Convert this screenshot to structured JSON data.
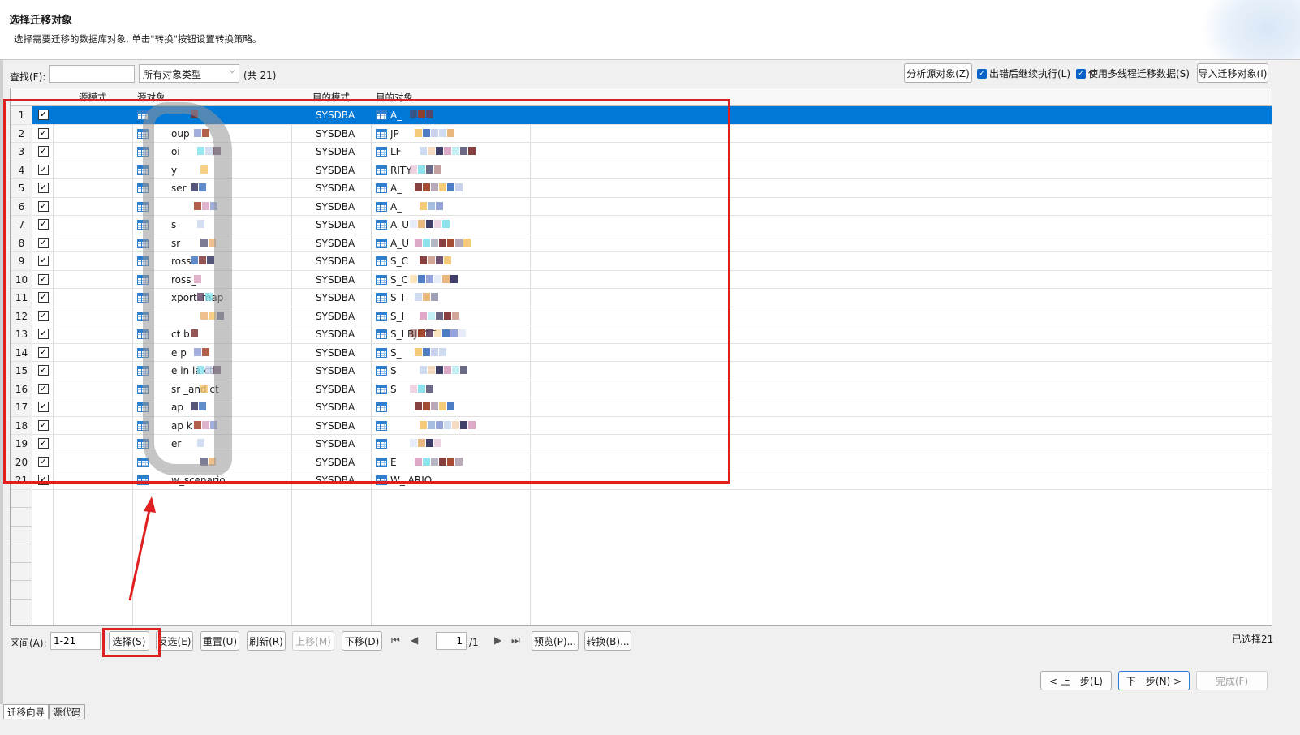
{
  "header": {
    "title": "选择迁移对象",
    "subtitle": "选择需要迁移的数据库对象, 单击\"转换\"按钮设置转换策略。"
  },
  "toolbar": {
    "find_label": "查找(F):",
    "find_value": "",
    "type_select": "所有对象类型",
    "total": "(共 21)",
    "analyze_button": "分析源对象(Z)",
    "continue_on_error": "出错后继续执行(L)",
    "multithread": "使用多线程迁移数据(S)",
    "import_button": "导入迁移对象(I)"
  },
  "table": {
    "columns": [
      "源模式",
      "源对象",
      "目的模式",
      "目的对象"
    ],
    "rows": [
      {
        "n": "1",
        "src": "",
        "dst_schema": "SYSDBA",
        "dst": "A_"
      },
      {
        "n": "2",
        "src": "oup",
        "dst_schema": "SYSDBA",
        "dst": "JP"
      },
      {
        "n": "3",
        "src": "oi",
        "dst_schema": "SYSDBA",
        "dst": "LF"
      },
      {
        "n": "4",
        "src": "y",
        "dst_schema": "SYSDBA",
        "dst": "RITY"
      },
      {
        "n": "5",
        "src": "ser",
        "dst_schema": "SYSDBA",
        "dst": "A_"
      },
      {
        "n": "6",
        "src": "",
        "dst_schema": "SYSDBA",
        "dst": "A_"
      },
      {
        "n": "7",
        "src": "s",
        "dst_schema": "SYSDBA",
        "dst": "A_U"
      },
      {
        "n": "8",
        "src": "sr",
        "dst_schema": "SYSDBA",
        "dst": "A_U"
      },
      {
        "n": "9",
        "src": "ross",
        "dst_schema": "SYSDBA",
        "dst": "S_C"
      },
      {
        "n": "10",
        "src": "ross_",
        "dst_schema": "SYSDBA",
        "dst": "S_C"
      },
      {
        "n": "11",
        "src": "xport_map",
        "dst_schema": "SYSDBA",
        "dst": "S_I"
      },
      {
        "n": "12",
        "src": "",
        "dst_schema": "SYSDBA",
        "dst": "S_I"
      },
      {
        "n": "13",
        "src": "ct b",
        "dst_schema": "SYSDBA",
        "dst": "S_I BJECT"
      },
      {
        "n": "14",
        "src": "e p",
        "dst_schema": "SYSDBA",
        "dst": "S_"
      },
      {
        "n": "15",
        "src": "e in la ct",
        "dst_schema": "SYSDBA",
        "dst": "S_"
      },
      {
        "n": "16",
        "src": "sr _and ct",
        "dst_schema": "SYSDBA",
        "dst": "S"
      },
      {
        "n": "17",
        "src": "ap",
        "dst_schema": "SYSDBA",
        "dst": ""
      },
      {
        "n": "18",
        "src": "ap k",
        "dst_schema": "SYSDBA",
        "dst": ""
      },
      {
        "n": "19",
        "src": "er",
        "dst_schema": "SYSDBA",
        "dst": ""
      },
      {
        "n": "20",
        "src": "",
        "dst_schema": "SYSDBA",
        "dst": "E"
      },
      {
        "n": "21",
        "src": "w_scenario",
        "dst_schema": "SYSDBA",
        "dst": "W_ ARIO"
      }
    ]
  },
  "bottom": {
    "range_label": "区间(A):",
    "range_value": "1-21",
    "select": "选择(S)",
    "invert": "反选(E)",
    "reset": "重置(U)",
    "refresh": "刷新(R)",
    "move_up": "上移(M)",
    "move_down": "下移(D)",
    "page": "1",
    "page_total": "/1",
    "preview": "预览(P)...",
    "convert": "转换(B)...",
    "selected_count": "已选择21"
  },
  "wizard": {
    "prev": "< 上一步(L)",
    "next": "下一步(N) >",
    "finish": "完成(F)"
  },
  "tabs": [
    "迁移向导",
    "源代码"
  ],
  "colors": {
    "selection": "#0078d7",
    "annotation_red": "#e02020",
    "checkbox_blue": "#0b63c9"
  }
}
